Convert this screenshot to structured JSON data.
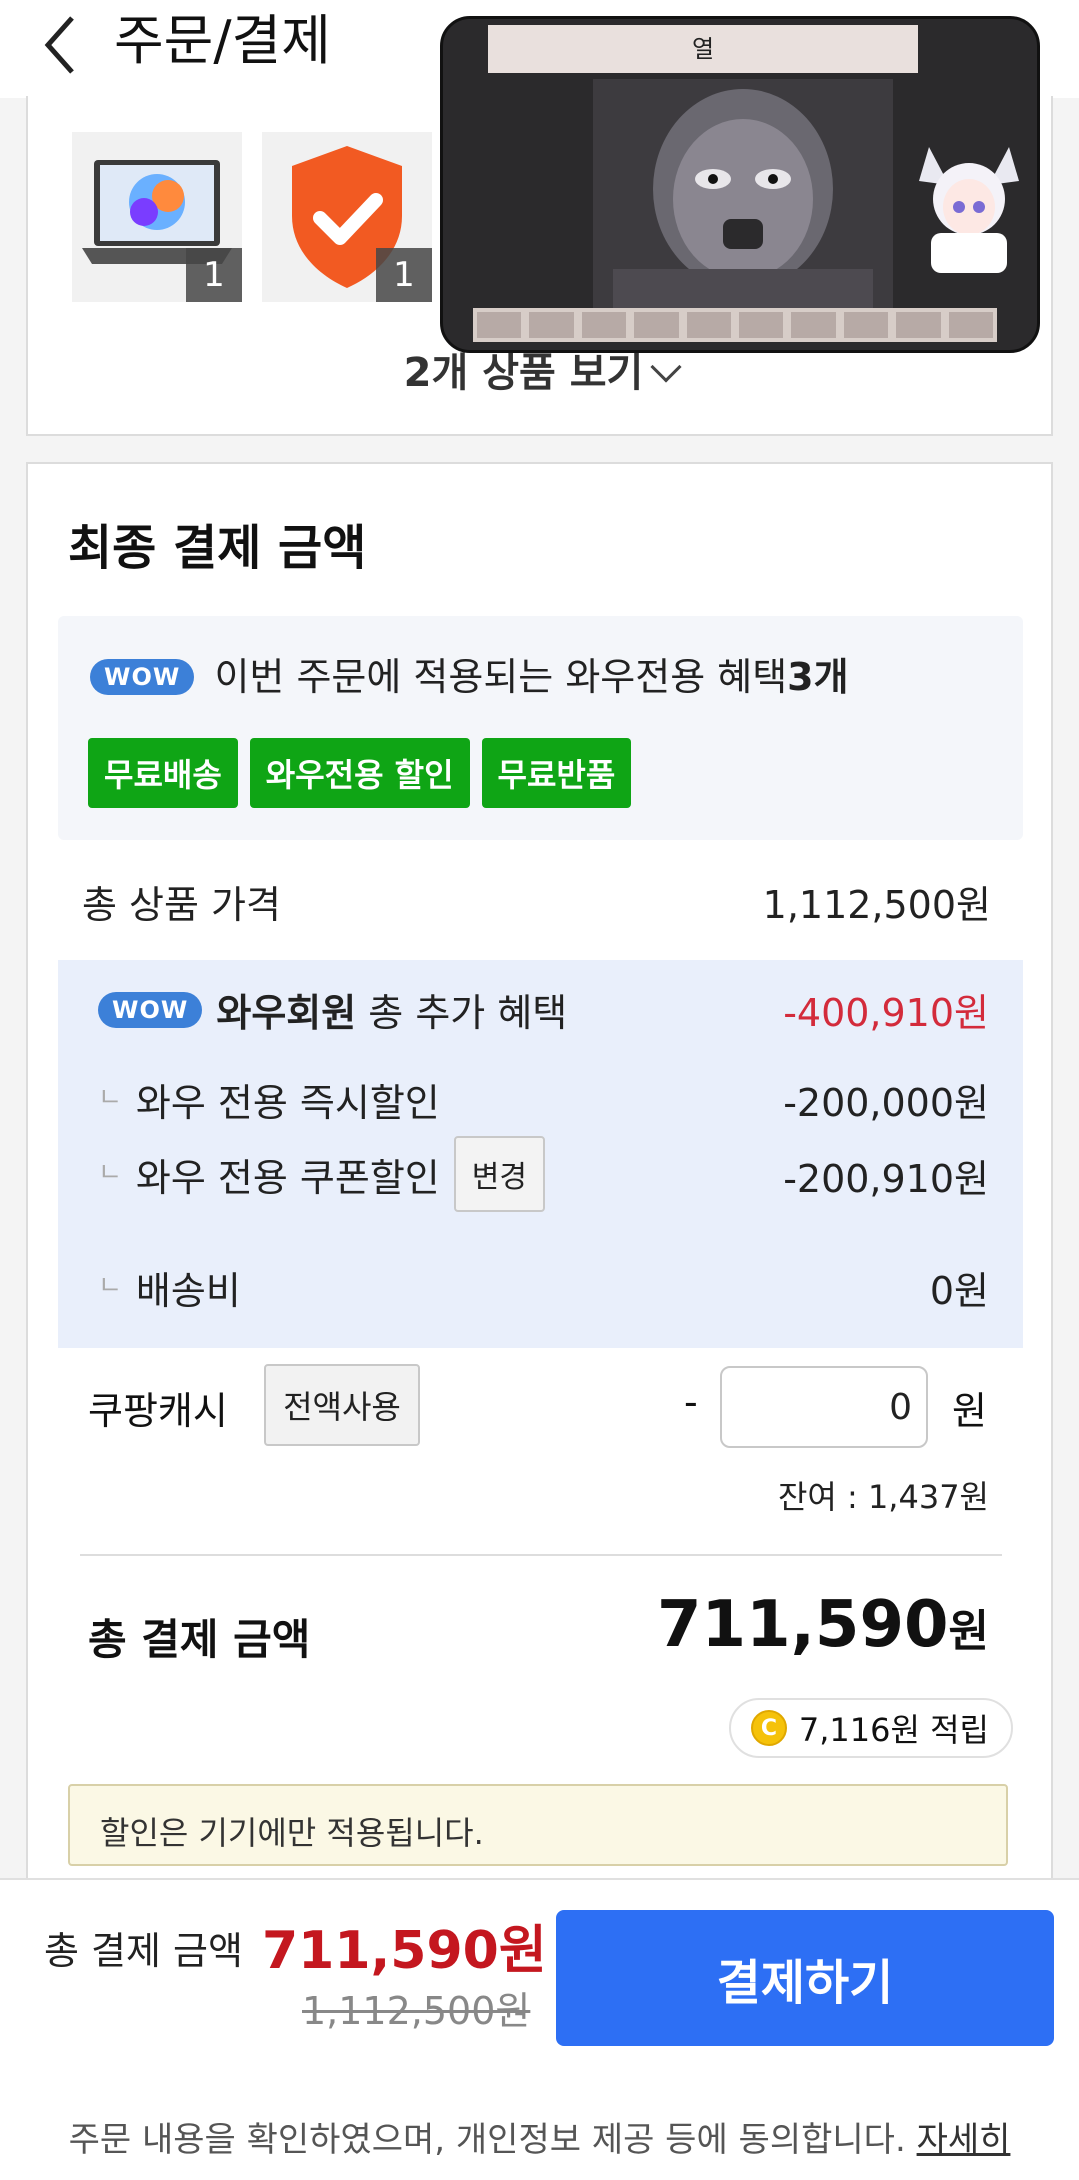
{
  "header": {
    "title": "주문/결제"
  },
  "products": {
    "items": [
      {
        "name": "laptop-thumbnail",
        "qty": "1"
      },
      {
        "name": "shield-thumbnail",
        "qty": "1"
      }
    ],
    "view_label": "2개 상품 보기"
  },
  "video": {
    "title": "열"
  },
  "final": {
    "title": "최종 결제 금액",
    "wow_badge": "WOW",
    "wow_prefix": "이번 주문에 적용되는 와우전용 혜택",
    "wow_count": "3개",
    "tags": [
      "무료배송",
      "와우전용 할인",
      "무료반품"
    ],
    "product_price_label": "총 상품 가격",
    "product_price": "1,112,500원",
    "benefit": {
      "badge": "WOW",
      "title_bold": "와우회원",
      "title_rest": " 총 추가 혜택",
      "total": "-400,910원",
      "rows": [
        {
          "label": "와우 전용 즉시할인",
          "value": "-200,000원"
        },
        {
          "label": "와우 전용 쿠폰할인",
          "value": "-200,910원",
          "button": "변경"
        },
        {
          "label": "배송비",
          "value": "0원"
        }
      ],
      "sub_mark": "ㄴ"
    },
    "cash": {
      "label": "쿠팡캐시",
      "use_all": "전액사용",
      "dash": "-",
      "input_value": "0",
      "unit": "원",
      "balance": "잔여 : 1,437원"
    },
    "total_label": "총 결제 금액",
    "total_amount": "711,590",
    "total_unit": "원",
    "reward_coin": "C",
    "reward": "7,116원 적립",
    "notice": "할인은 기기에만 적용됩니다."
  },
  "bottom": {
    "label": "총 결제 금액",
    "amount": "711,590원",
    "original": "1,112,500원",
    "pay_button": "결제하기",
    "consent_text": "주문 내용을 확인하였으며, 개인정보 제공 등에 동의합니다.",
    "consent_link": "자세히"
  },
  "colors": {
    "accent_blue": "#2d6ff4",
    "wow_green": "#0fa515",
    "discount_red": "#d32b3b",
    "price_red": "#c4171f"
  }
}
